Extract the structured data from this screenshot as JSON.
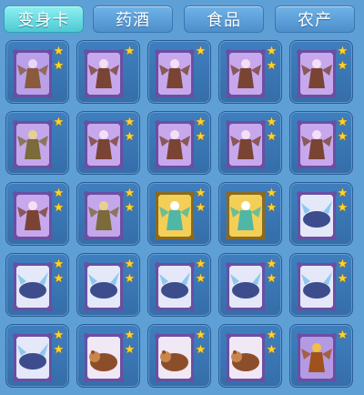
{
  "tabs": [
    {
      "label": "变身卡",
      "active": true
    },
    {
      "label": "药酒",
      "active": false
    },
    {
      "label": "食品",
      "active": false
    },
    {
      "label": "农产",
      "active": false
    }
  ],
  "items": [
    {
      "kind": "imp",
      "stars": 2
    },
    {
      "kind": "demon",
      "stars": 1
    },
    {
      "kind": "demon",
      "stars": 1
    },
    {
      "kind": "demon",
      "stars": 2
    },
    {
      "kind": "demon",
      "stars": 2
    },
    {
      "kind": "warrior",
      "stars": 1
    },
    {
      "kind": "demon",
      "stars": 2
    },
    {
      "kind": "demon",
      "stars": 2
    },
    {
      "kind": "demon",
      "stars": 2
    },
    {
      "kind": "demon",
      "stars": 2
    },
    {
      "kind": "demon",
      "stars": 2
    },
    {
      "kind": "warrior",
      "stars": 2
    },
    {
      "kind": "fairy",
      "stars": 2
    },
    {
      "kind": "fairy",
      "stars": 2
    },
    {
      "kind": "beast",
      "stars": 2
    },
    {
      "kind": "beast",
      "stars": 2
    },
    {
      "kind": "beast",
      "stars": 2
    },
    {
      "kind": "beast",
      "stars": 2
    },
    {
      "kind": "beast",
      "stars": 2
    },
    {
      "kind": "beast",
      "stars": 2
    },
    {
      "kind": "beast",
      "stars": 2
    },
    {
      "kind": "bear",
      "stars": 2
    },
    {
      "kind": "bear",
      "stars": 2
    },
    {
      "kind": "bear",
      "stars": 2
    },
    {
      "kind": "monkey",
      "stars": 1
    }
  ],
  "colors": {
    "background": "#5e9fd6",
    "slot": "#3f7fbf",
    "active_tab": "#6fe3e8",
    "star": "#ffd42a"
  }
}
